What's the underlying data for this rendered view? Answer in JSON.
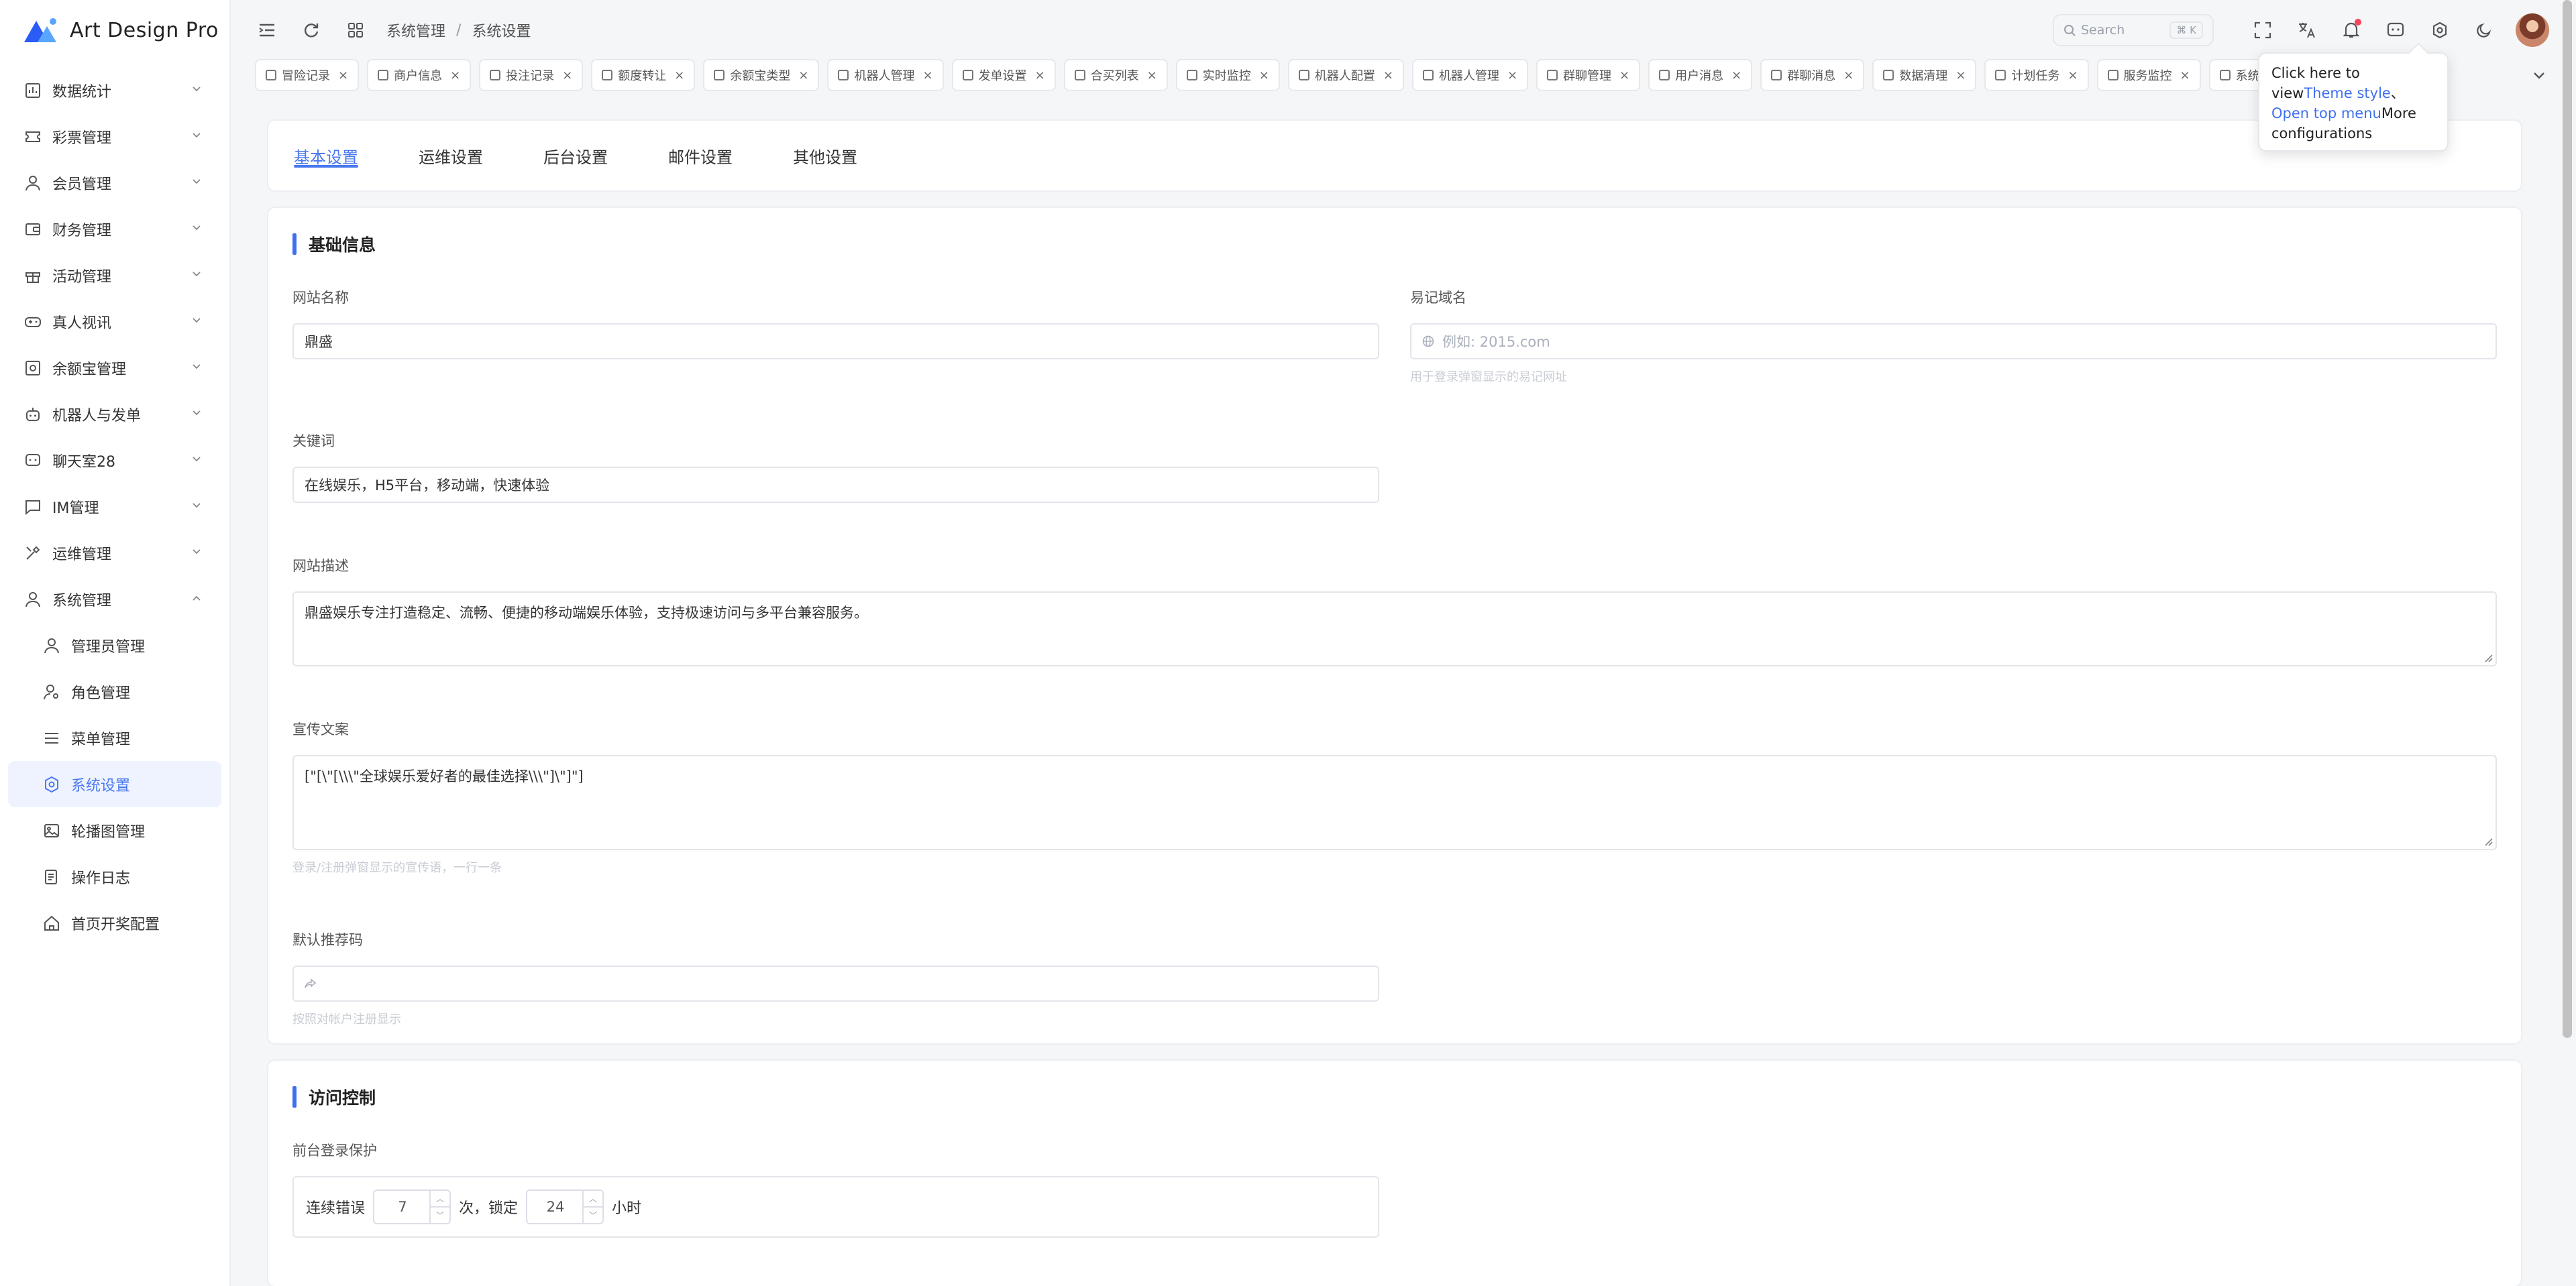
{
  "app": {
    "title": "Art Design Pro"
  },
  "sidebar": {
    "items": [
      {
        "label": "数据统计",
        "icon": "chart-icon"
      },
      {
        "label": "彩票管理",
        "icon": "ticket-icon"
      },
      {
        "label": "会员管理",
        "icon": "user-icon"
      },
      {
        "label": "财务管理",
        "icon": "wallet-icon"
      },
      {
        "label": "活动管理",
        "icon": "gift-icon"
      },
      {
        "label": "真人视讯",
        "icon": "gamepad-icon"
      },
      {
        "label": "余额宝管理",
        "icon": "safe-icon"
      },
      {
        "label": "机器人与发单",
        "icon": "robot-icon"
      },
      {
        "label": "聊天室28",
        "icon": "chat-icon"
      },
      {
        "label": "IM管理",
        "icon": "message-icon"
      },
      {
        "label": "运维管理",
        "icon": "tools-icon"
      },
      {
        "label": "系统管理",
        "icon": "user-icon"
      }
    ],
    "subitems": [
      {
        "label": "管理员管理",
        "icon": "user-icon"
      },
      {
        "label": "角色管理",
        "icon": "user-key-icon"
      },
      {
        "label": "菜单管理",
        "icon": "menu-icon"
      },
      {
        "label": "系统设置",
        "icon": "gear-icon"
      },
      {
        "label": "轮播图管理",
        "icon": "image-icon"
      },
      {
        "label": "操作日志",
        "icon": "log-icon"
      },
      {
        "label": "首页开奖配置",
        "icon": "home-icon"
      }
    ]
  },
  "header": {
    "breadcrumb": [
      "系统管理",
      "系统设置"
    ],
    "search": {
      "placeholder": "Search",
      "shortcut": "⌘ K"
    }
  },
  "page_tabs": [
    "冒险记录",
    "商户信息",
    "投注记录",
    "额度转让",
    "余额宝类型",
    "机器人管理",
    "发单设置",
    "合买列表",
    "实时监控",
    "机器人配置",
    "机器人管理",
    "群聊管理",
    "用户消息",
    "群聊消息",
    "数据清理",
    "计划任务",
    "服务监控",
    "系统设置"
  ],
  "tooltip": {
    "prefix": "Click here to view",
    "link1": "Theme style",
    "mid": "、",
    "link2": "Open top menu",
    "suffix": "More configurations"
  },
  "settings_tabs": [
    "基本设置",
    "运维设置",
    "后台设置",
    "邮件设置",
    "其他设置"
  ],
  "basic": {
    "section_title": "基础信息",
    "site_name": {
      "label": "网站名称",
      "value": "鼎盛"
    },
    "domain": {
      "label": "易记域名",
      "placeholder": "例如: 2015.com",
      "hint": "用于登录弹窗显示的易记网址"
    },
    "keywords": {
      "label": "关键词",
      "value": "在线娱乐，H5平台，移动端，快速体验"
    },
    "description": {
      "label": "网站描述",
      "value": "鼎盛娱乐专注打造稳定、流畅、便捷的移动端娱乐体验，支持极速访问与多平台兼容服务。"
    },
    "slogan": {
      "label": "宣传文案",
      "value": "[\"[\\\"[\\\\\\\"全球娱乐爱好者的最佳选择\\\\\\\"]\\\"]\"]",
      "hint": "登录/注册弹窗显示的宣传语，一行一条"
    },
    "ref_code": {
      "label": "默认推荐码",
      "hint": "按照对帐户注册显示"
    }
  },
  "access": {
    "section_title": "访问控制",
    "login_protect": {
      "label": "前台登录保护",
      "prefix": "连续错误",
      "attempts": "7",
      "mid": "次，锁定",
      "hours": "24",
      "suffix": "小时"
    }
  }
}
